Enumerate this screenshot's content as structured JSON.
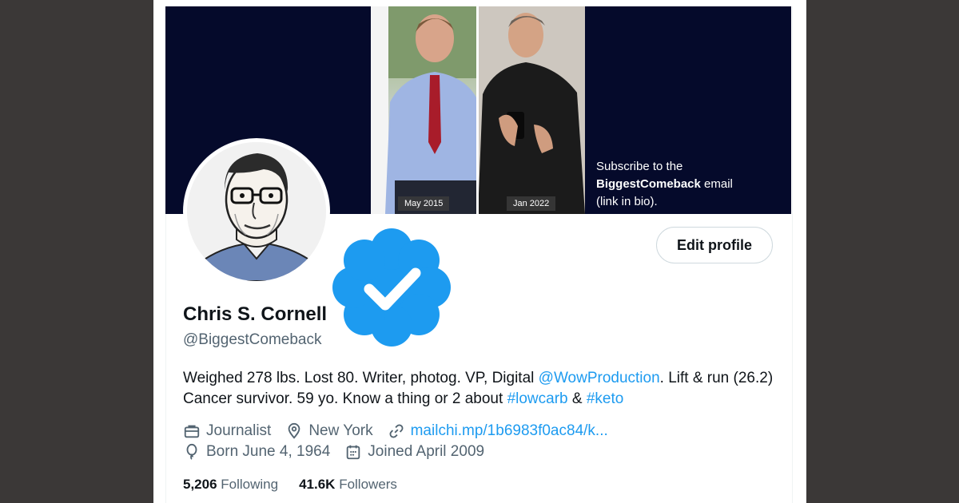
{
  "banner": {
    "before_label": "May 2015",
    "after_label": "Jan 2022",
    "subscribe_line1": "Subscribe to the",
    "subscribe_bold": "BiggestComeback",
    "subscribe_after_bold": " email",
    "subscribe_line3": "(link in bio)."
  },
  "profile": {
    "edit_label": "Edit profile",
    "name": "Chris S. Cornell",
    "handle": "@BiggestComeback",
    "bio": {
      "part1": "Weighed 278 lbs. Lost 80. Writer, photog. VP, Digital ",
      "mention": "@WowProduction",
      "part2": ". Lift & run (26.2) Cancer survivor. 59 yo. Know a thing or 2 about ",
      "hashtag1": "#lowcarb",
      "part3": " & ",
      "hashtag2": "#keto"
    },
    "meta": {
      "profession": "Journalist",
      "location": "New York",
      "url": "mailchi.mp/1b6983f0ac84/k...",
      "birthday": "Born June 4, 1964",
      "joined": "Joined April 2009"
    },
    "stats": {
      "following_count": "5,206",
      "following_label": " Following",
      "followers_count": "41.6K",
      "followers_label": " Followers"
    }
  },
  "icons": {
    "profession": "briefcase-icon",
    "location": "location-pin-icon",
    "url": "link-icon",
    "birthday": "balloon-icon",
    "joined": "calendar-icon",
    "verified": "verified-badge-icon"
  },
  "colors": {
    "accent": "#1d9bf0",
    "banner_bg": "#050a2b",
    "text": "#0f1419",
    "muted": "#536471",
    "background": "#3b3837"
  }
}
